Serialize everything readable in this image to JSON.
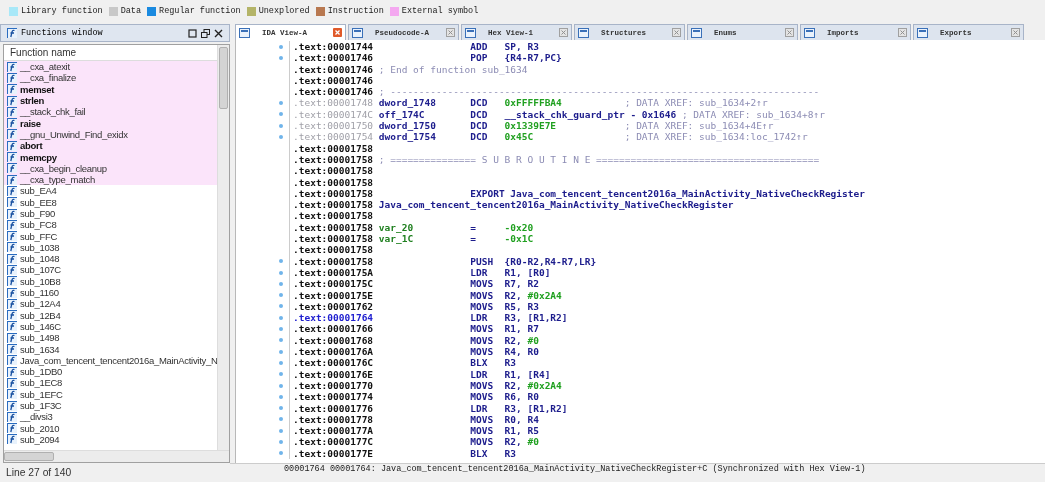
{
  "legend": [
    {
      "label": "Library function",
      "color": "#a8e8f8"
    },
    {
      "label": "Data",
      "color": "#c8c8c8"
    },
    {
      "label": "Regular function",
      "color": "#1a8ae0"
    },
    {
      "label": "Unexplored",
      "color": "#b4b468"
    },
    {
      "label": "Instruction",
      "color": "#b87850"
    },
    {
      "label": "External symbol",
      "color": "#f4a8f0"
    }
  ],
  "functions_window": {
    "title": "Functions window",
    "column": "Function name",
    "items": [
      {
        "name": "__cxa_atexit",
        "kind": "external",
        "bold": false
      },
      {
        "name": "__cxa_finalize",
        "kind": "external",
        "bold": false
      },
      {
        "name": "memset",
        "kind": "external",
        "bold": true
      },
      {
        "name": "strlen",
        "kind": "external",
        "bold": true
      },
      {
        "name": "__stack_chk_fail",
        "kind": "external",
        "bold": false
      },
      {
        "name": "raise",
        "kind": "external",
        "bold": true
      },
      {
        "name": "__gnu_Unwind_Find_exidx",
        "kind": "external",
        "bold": false
      },
      {
        "name": "abort",
        "kind": "external",
        "bold": true
      },
      {
        "name": "memcpy",
        "kind": "external",
        "bold": true
      },
      {
        "name": "__cxa_begin_cleanup",
        "kind": "external",
        "bold": false
      },
      {
        "name": "__cxa_type_match",
        "kind": "external",
        "bold": false
      },
      {
        "name": "sub_EA4",
        "kind": "regular",
        "bold": false
      },
      {
        "name": "sub_EE8",
        "kind": "regular",
        "bold": false
      },
      {
        "name": "sub_F90",
        "kind": "regular",
        "bold": false
      },
      {
        "name": "sub_FC8",
        "kind": "regular",
        "bold": false
      },
      {
        "name": "sub_FFC",
        "kind": "regular",
        "bold": false
      },
      {
        "name": "sub_1038",
        "kind": "regular",
        "bold": false
      },
      {
        "name": "sub_1048",
        "kind": "regular",
        "bold": false
      },
      {
        "name": "sub_107C",
        "kind": "regular",
        "bold": false
      },
      {
        "name": "sub_10B8",
        "kind": "regular",
        "bold": false
      },
      {
        "name": "sub_1160",
        "kind": "regular",
        "bold": false
      },
      {
        "name": "sub_12A4",
        "kind": "regular",
        "bold": false
      },
      {
        "name": "sub_12B4",
        "kind": "regular",
        "bold": false
      },
      {
        "name": "sub_146C",
        "kind": "regular",
        "bold": false
      },
      {
        "name": "sub_1498",
        "kind": "regular",
        "bold": false
      },
      {
        "name": "sub_1634",
        "kind": "regular",
        "bold": false
      },
      {
        "name": "Java_com_tencent_tencent2016a_MainActivity_N",
        "kind": "regular",
        "bold": false
      },
      {
        "name": "sub_1DB0",
        "kind": "regular",
        "bold": false
      },
      {
        "name": "sub_1EC8",
        "kind": "regular",
        "bold": false
      },
      {
        "name": "sub_1EFC",
        "kind": "regular",
        "bold": false
      },
      {
        "name": "sub_1F3C",
        "kind": "regular",
        "bold": false
      },
      {
        "name": "__divsi3",
        "kind": "regular",
        "bold": false
      },
      {
        "name": "sub_2010",
        "kind": "regular",
        "bold": false
      },
      {
        "name": "sub_2094",
        "kind": "regular",
        "bold": false
      }
    ],
    "status": "Line 27 of 140"
  },
  "tabs": [
    {
      "label": "IDA View-A",
      "selected": true
    },
    {
      "label": "Pseudocode-A",
      "selected": false
    },
    {
      "label": "Hex View-1",
      "selected": false
    },
    {
      "label": "Structures",
      "selected": false
    },
    {
      "label": "Enums",
      "selected": false
    },
    {
      "label": "Imports",
      "selected": false
    },
    {
      "label": "Exports",
      "selected": false
    }
  ],
  "disassembly": {
    "lines": [
      {
        "kind": "ins",
        "address": ".text:00001744",
        "marked": true,
        "selected": false,
        "mnemonic": "ADD",
        "operands": "SP, R3"
      },
      {
        "kind": "ins",
        "address": ".text:00001746",
        "marked": true,
        "selected": false,
        "mnemonic": "POP",
        "operands": "{R4-R7,PC}"
      },
      {
        "kind": "comment",
        "address": ".text:00001746",
        "marked": false,
        "selected": false,
        "text": "; End of function sub_1634"
      },
      {
        "kind": "blank",
        "address": ".text:00001746",
        "marked": false,
        "selected": false
      },
      {
        "kind": "comment",
        "address": ".text:00001746",
        "marked": false,
        "selected": false,
        "text": "; ---------------------------------------------------------------------------"
      },
      {
        "kind": "data",
        "address": ".text:00001748",
        "marked": true,
        "selected": false,
        "label": "dword_1748",
        "mnemonic": "DCD",
        "imm": "0xFFFFFBA4",
        "comment": "; DATA XREF: sub_1634+2↑r"
      },
      {
        "kind": "data",
        "address": ".text:0000174C",
        "marked": true,
        "selected": false,
        "label": "off_174C",
        "mnemonic": "DCD",
        "operands": "__stack_chk_guard_ptr - 0x1646",
        "comment": "; DATA XREF: sub_1634+8↑r"
      },
      {
        "kind": "data",
        "address": ".text:00001750",
        "marked": true,
        "selected": false,
        "label": "dword_1750",
        "mnemonic": "DCD",
        "imm": "0x1339E7E",
        "comment": "; DATA XREF: sub_1634+4E↑r"
      },
      {
        "kind": "data",
        "address": ".text:00001754",
        "marked": true,
        "selected": false,
        "label": "dword_1754",
        "mnemonic": "DCD",
        "imm": "0x45C",
        "comment": "; DATA XREF: sub_1634:loc_1742↑r"
      },
      {
        "kind": "blank",
        "address": ".text:00001758",
        "marked": false,
        "selected": false
      },
      {
        "kind": "comment",
        "address": ".text:00001758",
        "marked": false,
        "selected": false,
        "text": "; =============== S U B R O U T I N E ======================================="
      },
      {
        "kind": "blank",
        "address": ".text:00001758",
        "marked": false,
        "selected": false
      },
      {
        "kind": "blank",
        "address": ".text:00001758",
        "marked": false,
        "selected": false
      },
      {
        "kind": "ins",
        "address": ".text:00001758",
        "marked": false,
        "selected": false,
        "mnemonic": "EXPORT",
        "operands": "Java_com_tencent_tencent2016a_MainActivity_NativeCheckRegister"
      },
      {
        "kind": "label",
        "address": ".text:00001758",
        "marked": false,
        "selected": false,
        "label": "Java_com_tencent_tencent2016a_MainActivity_NativeCheckRegister"
      },
      {
        "kind": "blank",
        "address": ".text:00001758",
        "marked": false,
        "selected": false
      },
      {
        "kind": "var",
        "address": ".text:00001758",
        "marked": false,
        "selected": false,
        "label": "var_20",
        "mnemonic": "=",
        "imm": "-0x20"
      },
      {
        "kind": "var",
        "address": ".text:00001758",
        "marked": false,
        "selected": false,
        "label": "var_1C",
        "mnemonic": "=",
        "imm": "-0x1C"
      },
      {
        "kind": "blank",
        "address": ".text:00001758",
        "marked": false,
        "selected": false
      },
      {
        "kind": "ins",
        "address": ".text:00001758",
        "marked": true,
        "selected": false,
        "mnemonic": "PUSH",
        "operands": "{R0-R2,R4-R7,LR}"
      },
      {
        "kind": "ins",
        "address": ".text:0000175A",
        "marked": true,
        "selected": false,
        "mnemonic": "LDR",
        "operands": "R1, [R0]"
      },
      {
        "kind": "ins",
        "address": ".text:0000175C",
        "marked": true,
        "selected": false,
        "mnemonic": "MOVS",
        "operands": "R7, R2"
      },
      {
        "kind": "ins",
        "address": ".text:0000175E",
        "marked": true,
        "selected": false,
        "mnemonic": "MOVS",
        "operands": "R2, ",
        "imm": "#0x2A4"
      },
      {
        "kind": "ins",
        "address": ".text:00001762",
        "marked": true,
        "selected": false,
        "mnemonic": "MOVS",
        "operands": "R5, R3"
      },
      {
        "kind": "ins",
        "address": ".text:00001764",
        "marked": true,
        "selected": true,
        "mnemonic": "LDR",
        "operands": "R3, [R1,R2]"
      },
      {
        "kind": "ins",
        "address": ".text:00001766",
        "marked": true,
        "selected": false,
        "mnemonic": "MOVS",
        "operands": "R1, R7"
      },
      {
        "kind": "ins",
        "address": ".text:00001768",
        "marked": true,
        "selected": false,
        "mnemonic": "MOVS",
        "operands": "R2, ",
        "imm": "#0"
      },
      {
        "kind": "ins",
        "address": ".text:0000176A",
        "marked": true,
        "selected": false,
        "mnemonic": "MOVS",
        "operands": "R4, R0"
      },
      {
        "kind": "ins",
        "address": ".text:0000176C",
        "marked": true,
        "selected": false,
        "mnemonic": "BLX",
        "operands": "R3"
      },
      {
        "kind": "ins",
        "address": ".text:0000176E",
        "marked": true,
        "selected": false,
        "mnemonic": "LDR",
        "operands": "R1, [R4]"
      },
      {
        "kind": "ins",
        "address": ".text:00001770",
        "marked": true,
        "selected": false,
        "mnemonic": "MOVS",
        "operands": "R2, ",
        "imm": "#0x2A4"
      },
      {
        "kind": "ins",
        "address": ".text:00001774",
        "marked": true,
        "selected": false,
        "mnemonic": "MOVS",
        "operands": "R6, R0"
      },
      {
        "kind": "ins",
        "address": ".text:00001776",
        "marked": true,
        "selected": false,
        "mnemonic": "LDR",
        "operands": "R3, [R1,R2]"
      },
      {
        "kind": "ins",
        "address": ".text:00001778",
        "marked": true,
        "selected": false,
        "mnemonic": "MOVS",
        "operands": "R0, R4"
      },
      {
        "kind": "ins",
        "address": ".text:0000177A",
        "marked": true,
        "selected": false,
        "mnemonic": "MOVS",
        "operands": "R1, R5"
      },
      {
        "kind": "ins",
        "address": ".text:0000177C",
        "marked": true,
        "selected": false,
        "mnemonic": "MOVS",
        "operands": "R2, ",
        "imm": "#0"
      },
      {
        "kind": "ins",
        "address": ".text:0000177E",
        "marked": true,
        "selected": false,
        "mnemonic": "BLX",
        "operands": "R3"
      }
    ],
    "status": "00001764 00001764: Java_com_tencent_tencent2016a_MainActivity_NativeCheckRegister+C (Synchronized with Hex View-1)"
  }
}
